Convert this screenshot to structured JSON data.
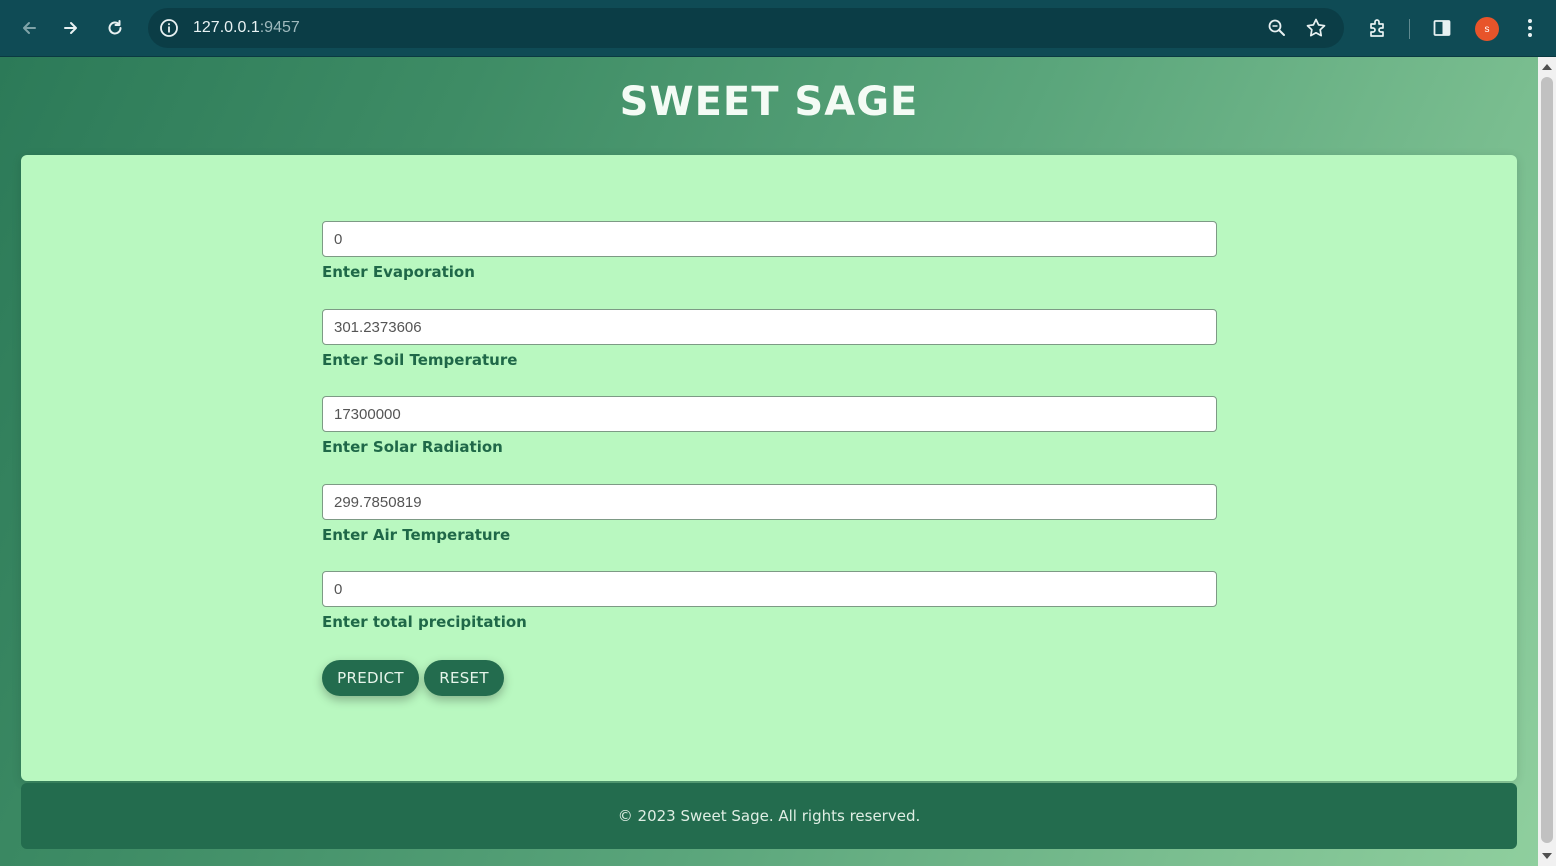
{
  "browser": {
    "url_host": "127.0.0.1",
    "url_port": ":9457",
    "profile_initial": "s",
    "icons": [
      "back-arrow-icon",
      "forward-arrow-icon",
      "reload-icon",
      "info-icon",
      "zoom-icon",
      "star-icon",
      "extensions-icon",
      "side-panel-icon",
      "kebab-menu-icon"
    ]
  },
  "page": {
    "title": "SWEET SAGE",
    "fields": [
      {
        "value": "0",
        "label": "Enter Evaporation"
      },
      {
        "value": "301.2373606",
        "label": "Enter Soil Temperature"
      },
      {
        "value": "17300000",
        "label": "Enter Solar Radiation"
      },
      {
        "value": "299.7850819",
        "label": "Enter Air Temperature"
      },
      {
        "value": "0",
        "label": "Enter total precipitation"
      }
    ],
    "buttons": {
      "predict": "PREDICT",
      "reset": "RESET"
    },
    "footer": "© 2023 Sweet Sage. All rights reserved."
  },
  "colors": {
    "chrome": "#0f4b55",
    "card": "#b9f8c0",
    "accent": "#236c4e",
    "label": "#1f6848"
  }
}
